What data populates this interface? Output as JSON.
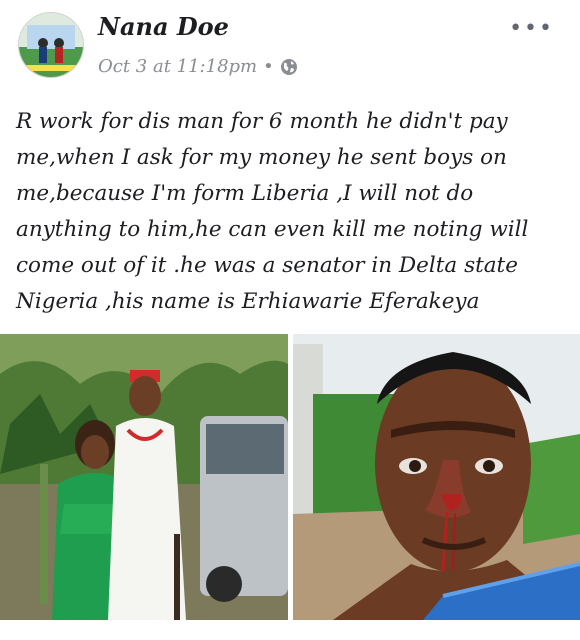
{
  "post": {
    "author": "Nana Doe",
    "timestamp": "Oct 3 at 11:18pm",
    "separator": "•",
    "privacy_icon": "globe-icon",
    "more_icon": "more-options-icon",
    "more_label": "•••",
    "text": "R work for dis man for 6 month he didn't pay me,when I ask for my money he sent boys on me,because I'm form Liberia ,I will not do anything to him,he can even kill me noting will come out of it .he was a senator in Delta state Nigeria ,his name is Erhiawarie Eferakeya"
  },
  "photos": [
    {
      "name": "photo-couple",
      "description_icon": "couple-photo"
    },
    {
      "name": "photo-injured-man",
      "description_icon": "injured-face-photo"
    }
  ],
  "colors": {
    "text": "#1c1e21",
    "meta": "#8a8d91",
    "accent_green": "#1e9e4e"
  }
}
